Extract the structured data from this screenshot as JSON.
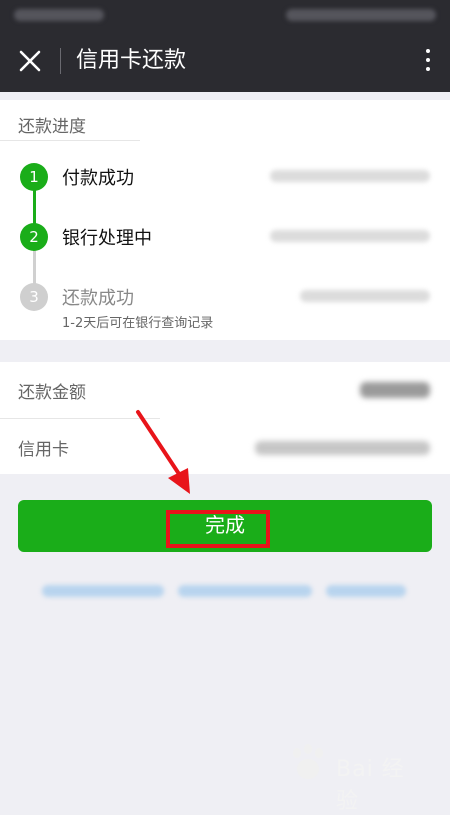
{
  "header": {
    "title": "信用卡还款",
    "close_icon": "close-icon",
    "more_icon": "more-vertical-icon"
  },
  "progress": {
    "section_label": "还款进度",
    "steps": [
      {
        "number": "1",
        "label": "付款成功",
        "status": "done"
      },
      {
        "number": "2",
        "label": "银行处理中",
        "status": "done"
      },
      {
        "number": "3",
        "label": "还款成功",
        "sub": "1-2天后可在银行查询记录",
        "status": "pending"
      }
    ]
  },
  "details": {
    "amount_label": "还款金额",
    "card_label": "信用卡"
  },
  "actions": {
    "done_label": "完成"
  },
  "watermark": {
    "logo": "baidu-paw-logo",
    "text": "Bai 经验"
  },
  "colors": {
    "accent_green": "#1aad19",
    "titlebar_bg": "#2b2b30",
    "annotation_red": "#e8141a"
  }
}
